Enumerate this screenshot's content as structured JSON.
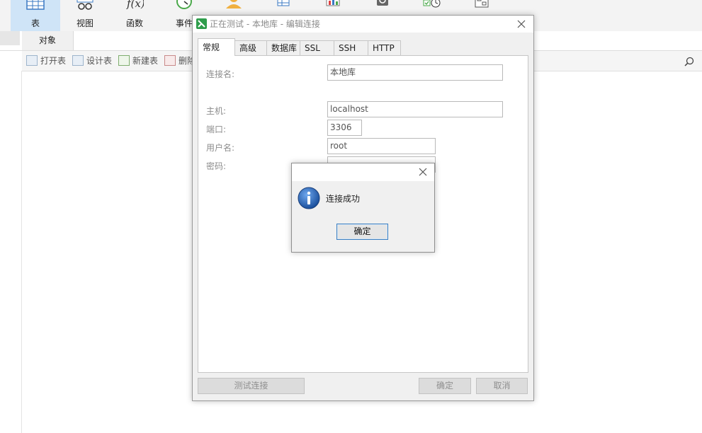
{
  "ribbon": {
    "items": [
      {
        "label": "表",
        "icon": "table-icon",
        "active": true
      },
      {
        "label": "视图",
        "icon": "view-icon"
      },
      {
        "label": "函数",
        "icon": "function-icon"
      },
      {
        "label": "事件",
        "icon": "event-icon"
      },
      {
        "label": "",
        "icon": "user-icon"
      },
      {
        "label": "",
        "icon": "query-icon"
      },
      {
        "label": "",
        "icon": "report-icon"
      },
      {
        "label": "",
        "icon": "backup-icon"
      },
      {
        "label": "",
        "icon": "schedule-icon"
      },
      {
        "label": "",
        "icon": "model-icon"
      }
    ]
  },
  "tabs": {
    "objects": "对象"
  },
  "object_toolbar": {
    "open_table": "打开表",
    "design_table": "设计表",
    "new_table": "新建表",
    "delete": "删除"
  },
  "conn_dialog": {
    "title": "正在测试 - 本地库 - 编辑连接",
    "tabs": [
      "常规",
      "高级",
      "数据库",
      "SSL",
      "SSH",
      "HTTP"
    ],
    "active_tab": "常规",
    "fields": {
      "conn_name_label": "连接名:",
      "conn_name_value": "本地库",
      "host_label": "主机:",
      "host_value": "localhost",
      "port_label": "端口:",
      "port_value": "3306",
      "user_label": "用户名:",
      "user_value": "root",
      "password_label": "密码:"
    },
    "buttons": {
      "test": "测试连接",
      "ok": "确定",
      "cancel": "取消"
    }
  },
  "message_box": {
    "text": "连接成功",
    "ok": "确定"
  },
  "colors": {
    "ribbon_active": "#cfe4f7",
    "info_icon": "#1f5fae",
    "default_button_border": "#3c7fc1"
  }
}
